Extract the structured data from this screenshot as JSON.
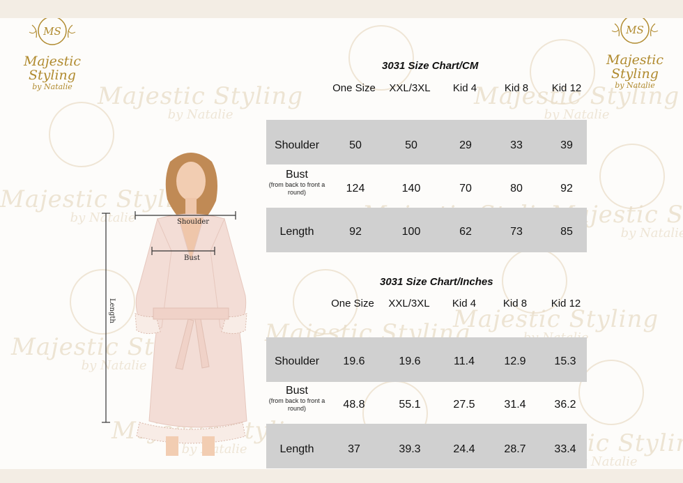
{
  "brand": {
    "name": "Majestic Styling",
    "byline": "by Natalie",
    "monogram": "MS",
    "color": "#b08a2e"
  },
  "figure": {
    "shoulder_label": "Shoulder",
    "bust_label": "Bust",
    "length_label": "Length",
    "robe_color": "#f3ddd6"
  },
  "cm_chart": {
    "title": "3031 Size Chart/CM",
    "columns": [
      "One Size",
      "XXL/3XL",
      "Kid 4",
      "Kid 8",
      "Kid 12"
    ],
    "rows": [
      {
        "label": "Shoulder",
        "note": "",
        "values": [
          "50",
          "50",
          "29",
          "33",
          "39"
        ]
      },
      {
        "label": "Bust",
        "note": "(from back to front a round)",
        "values": [
          "124",
          "140",
          "70",
          "80",
          "92"
        ]
      },
      {
        "label": "Length",
        "note": "",
        "values": [
          "92",
          "100",
          "62",
          "73",
          "85"
        ]
      }
    ]
  },
  "inch_chart": {
    "title": "3031 Size Chart/Inches",
    "columns": [
      "One Size",
      "XXL/3XL",
      "Kid 4",
      "Kid 8",
      "Kid 12"
    ],
    "rows": [
      {
        "label": "Shoulder",
        "note": "",
        "values": [
          "19.6",
          "19.6",
          "11.4",
          "12.9",
          "15.3"
        ]
      },
      {
        "label": "Bust",
        "note": "(from back to front a round)",
        "values": [
          "48.8",
          "55.1",
          "27.5",
          "31.4",
          "36.2"
        ]
      },
      {
        "label": "Length",
        "note": "",
        "values": [
          "37",
          "39.3",
          "24.4",
          "28.7",
          "33.4"
        ]
      }
    ]
  }
}
